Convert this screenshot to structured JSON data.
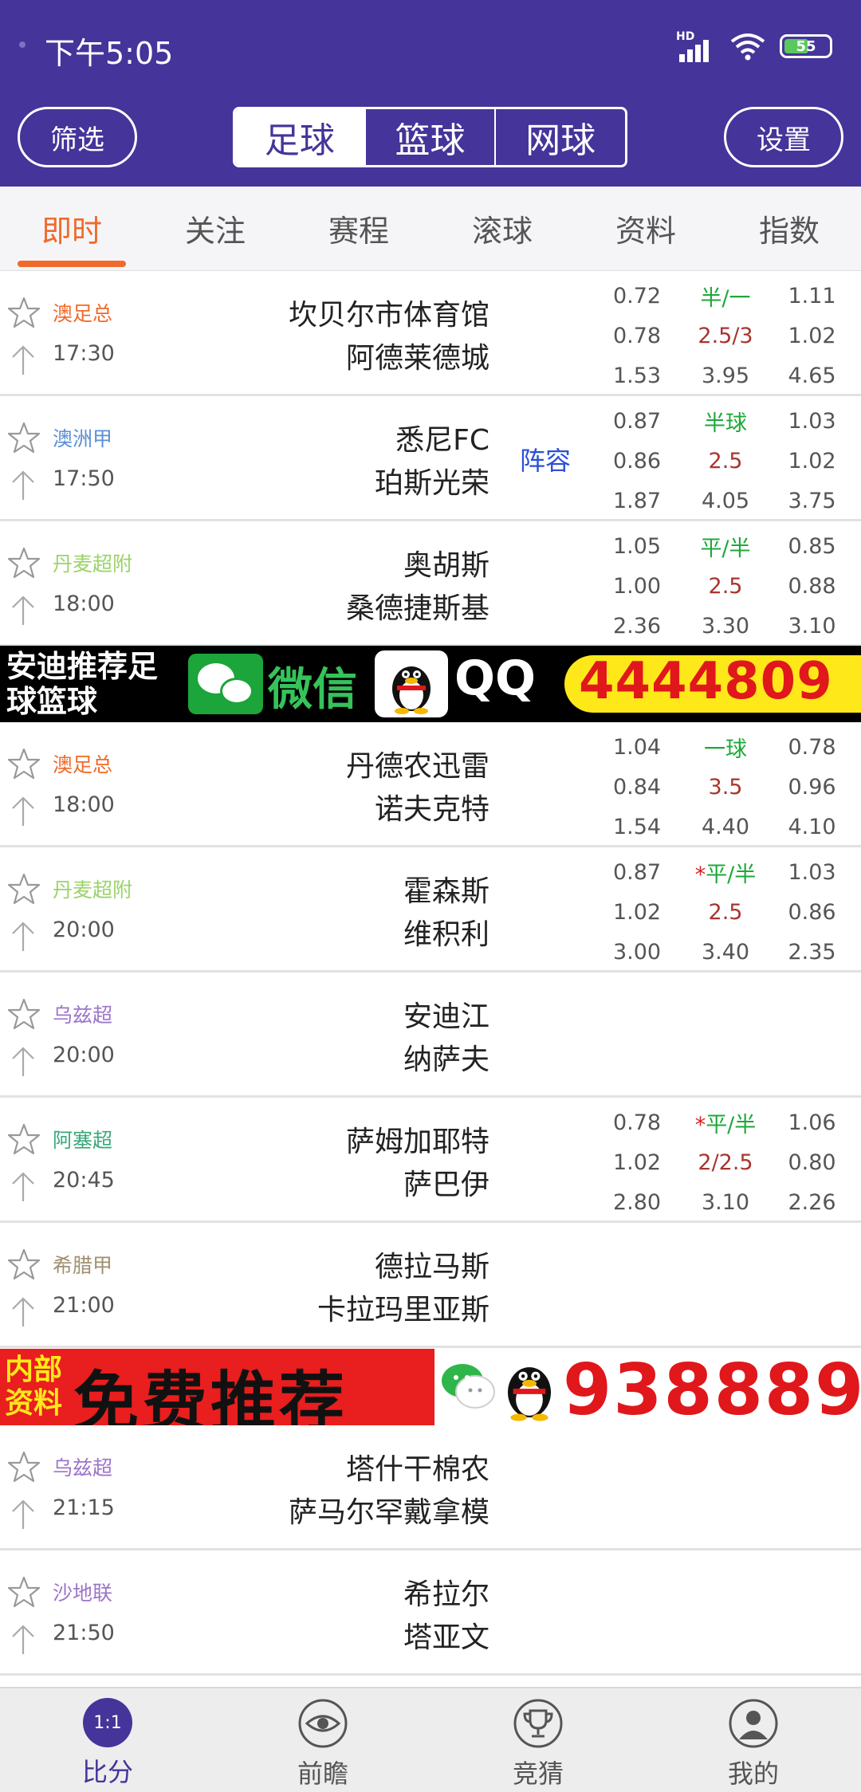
{
  "status_bar": {
    "time": "下午5:05",
    "network": "HD",
    "battery": "55"
  },
  "header": {
    "filter_label": "筛选",
    "settings_label": "设置",
    "sport_tabs": [
      {
        "label": "足球",
        "active": true
      },
      {
        "label": "篮球",
        "active": false
      },
      {
        "label": "网球",
        "active": false
      }
    ]
  },
  "sub_tabs": [
    {
      "label": "即时",
      "active": true
    },
    {
      "label": "关注",
      "active": false
    },
    {
      "label": "赛程",
      "active": false
    },
    {
      "label": "滚球",
      "active": false
    },
    {
      "label": "资料",
      "active": false
    },
    {
      "label": "指数",
      "active": false
    }
  ],
  "matches": [
    {
      "league": "澳足总",
      "league_color": "#f06a2b",
      "time": "17:30",
      "home": "坎贝尔市体育馆",
      "away": "阿德莱德城",
      "lineup": "",
      "odds": [
        [
          "0.72",
          "半/一",
          "1.11"
        ],
        [
          "0.78",
          "2.5/3",
          "1.02"
        ],
        [
          "1.53",
          "3.95",
          "4.65"
        ]
      ]
    },
    {
      "league": "澳洲甲",
      "league_color": "#5b8fd6",
      "time": "17:50",
      "home": "悉尼FC",
      "away": "珀斯光荣",
      "lineup": "阵容",
      "odds": [
        [
          "0.87",
          "半球",
          "1.03"
        ],
        [
          "0.86",
          "2.5",
          "1.02"
        ],
        [
          "1.87",
          "4.05",
          "3.75"
        ]
      ]
    },
    {
      "league": "丹麦超附",
      "league_color": "#9bd36a",
      "time": "18:00",
      "home": "奥胡斯",
      "away": "桑德捷斯基",
      "lineup": "",
      "odds": [
        [
          "1.05",
          "平/半",
          "0.85"
        ],
        [
          "1.00",
          "2.5",
          "0.88"
        ],
        [
          "2.36",
          "3.30",
          "3.10"
        ]
      ]
    },
    {
      "league": "澳足总",
      "league_color": "#f06a2b",
      "time": "18:00",
      "home": "丹德农迅雷",
      "away": "诺夫克特",
      "lineup": "",
      "odds": [
        [
          "1.04",
          "一球",
          "0.78"
        ],
        [
          "0.84",
          "3.5",
          "0.96"
        ],
        [
          "1.54",
          "4.40",
          "4.10"
        ]
      ]
    },
    {
      "league": "丹麦超附",
      "league_color": "#9bd36a",
      "time": "20:00",
      "home": "霍森斯",
      "away": "维积利",
      "lineup": "",
      "odds": [
        [
          "0.87",
          "*平/半",
          "1.03"
        ],
        [
          "1.02",
          "2.5",
          "0.86"
        ],
        [
          "3.00",
          "3.40",
          "2.35"
        ]
      ]
    },
    {
      "league": "乌兹超",
      "league_color": "#9d74c9",
      "time": "20:00",
      "home": "安迪江",
      "away": "纳萨夫",
      "lineup": "",
      "odds": []
    },
    {
      "league": "阿塞超",
      "league_color": "#3aa87a",
      "time": "20:45",
      "home": "萨姆加耶特",
      "away": "萨巴伊",
      "lineup": "",
      "odds": [
        [
          "0.78",
          "*平/半",
          "1.06"
        ],
        [
          "1.02",
          "2/2.5",
          "0.80"
        ],
        [
          "2.80",
          "3.10",
          "2.26"
        ]
      ]
    },
    {
      "league": "希腊甲",
      "league_color": "#a09070",
      "time": "21:00",
      "home": "德拉马斯",
      "away": "卡拉玛里亚斯",
      "lineup": "",
      "odds": []
    },
    {
      "league": "乌兹超",
      "league_color": "#9d74c9",
      "time": "21:15",
      "home": "塔什干棉农",
      "away": "萨马尔罕戴拿模",
      "lineup": "",
      "odds": []
    },
    {
      "league": "沙地联",
      "league_color": "#9d74c9",
      "time": "21:50",
      "home": "希拉尔",
      "away": "塔亚文",
      "lineup": "",
      "odds": []
    }
  ],
  "banner1": {
    "text": "安迪推荐足球篮球",
    "wechat": "微信",
    "qq": "QQ",
    "number": "4444809"
  },
  "banner2": {
    "small": "内部资料",
    "big": "免费推荐",
    "number": "938889"
  },
  "bottom_nav": [
    {
      "label": "比分",
      "icon": "score-icon",
      "icon_text": "1:1",
      "active": true
    },
    {
      "label": "前瞻",
      "icon": "eye-icon",
      "active": false
    },
    {
      "label": "竞猜",
      "icon": "trophy-icon",
      "active": false
    },
    {
      "label": "我的",
      "icon": "user-icon",
      "active": false
    }
  ],
  "colors": {
    "brand": "#45349a",
    "accent": "#f06a2b",
    "handicap": "#1ea83a",
    "goal_line": "#a8352e"
  }
}
